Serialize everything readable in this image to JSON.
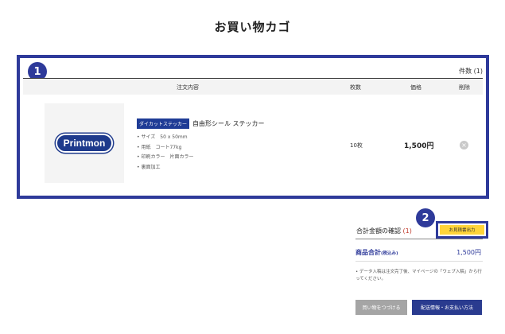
{
  "page": {
    "title": "お買い物カゴ"
  },
  "cart": {
    "badge": "1",
    "count_label": "件数",
    "count_value": "(1)",
    "headers": {
      "content": "注文内容",
      "quantity": "枚数",
      "price": "価格",
      "delete": "削除"
    },
    "item": {
      "logo_text": "Printmon",
      "category_tag": "ダイカットステッカー",
      "name": "自由形シール ステッカー",
      "specs": [
        "サイズ　50 x 50mm",
        "用紙　コート77kg",
        "印刷カラー　片面カラー",
        "裏面加工"
      ],
      "quantity": "10枚",
      "price": "1,500円",
      "delete_icon": "×"
    }
  },
  "summary": {
    "badge": "2",
    "title": "合計金額の確認",
    "count": "(1)",
    "quote_button": "お見積書出力",
    "subtotal_label": "商品合計",
    "tax_note": "(税込み)",
    "subtotal_value": "1,500円",
    "notice": "データ入稿は注文完了後、マイページの「ウェブ入稿」から行ってください。",
    "continue_button": "買い物をつづける",
    "checkout_button": "配送情報・お支払い方法"
  },
  "colors": {
    "accent": "#2e3a9a",
    "highlight": "#ffd43a",
    "price_red": "#c0392b"
  }
}
